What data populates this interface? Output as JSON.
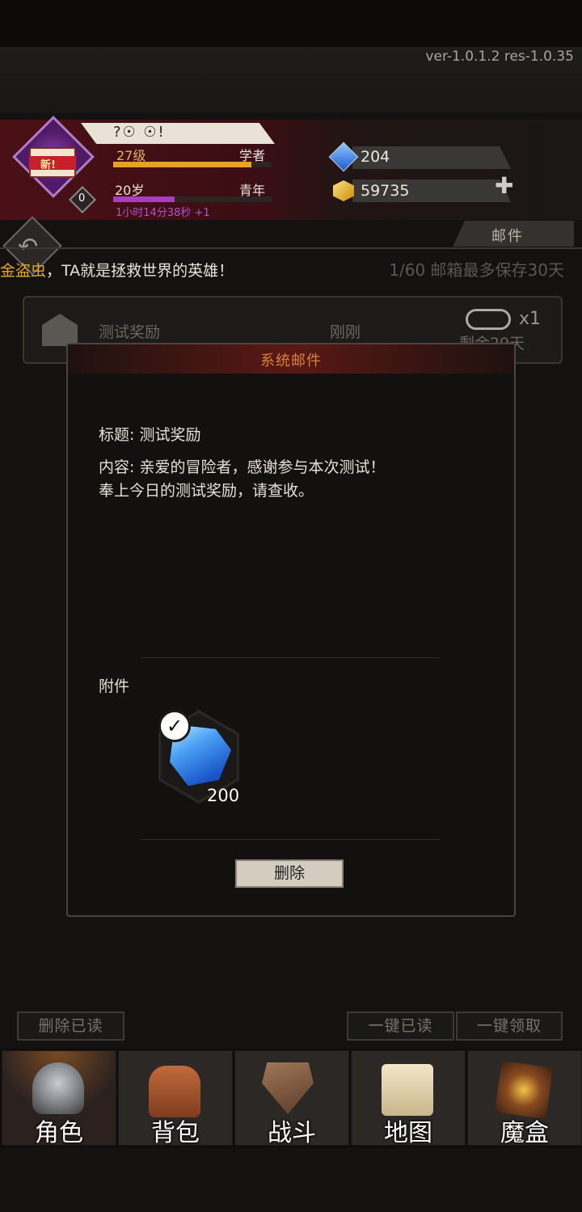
{
  "version": "ver-1.0.1.2  res-1.0.35",
  "profile": {
    "new_badge": "新!",
    "avatar_level": "0",
    "name": "?☉ ☉!",
    "level": "27级",
    "class": "学者",
    "level_progress": 0.87,
    "age": "20岁",
    "life_stage": "青年",
    "age_progress": 0.39,
    "timer": "1小时14分38秒 +1"
  },
  "resources": {
    "diamonds": "204",
    "gold": "59735",
    "add_icon": "plus-icon"
  },
  "mail_tab": "邮件",
  "ticker": {
    "highlight": "金盗虫",
    "text": "，TA就是拯救世界的英雄！"
  },
  "mailbox_status": "1/60 邮箱最多保存30天",
  "mail_list": [
    {
      "subject": "测试奖励",
      "time": "刚刚",
      "attachments": "x1",
      "remaining": "剩余29天"
    }
  ],
  "dialog": {
    "title": "系统邮件",
    "subject_line": "标题: 测试奖励",
    "content_line1": "内容: 亲爱的冒险者，感谢参与本次测试！",
    "content_line2": "奉上今日的测试奖励，请查收。",
    "attachments_label": "附件",
    "attachment_qty": "200",
    "delete_button": "删除"
  },
  "bottom_actions": {
    "delete_read": "删除已读",
    "mark_all_read": "一键已读",
    "claim_all": "一键领取"
  },
  "nav": [
    {
      "label": "角色",
      "icon": "helmet-icon"
    },
    {
      "label": "背包",
      "icon": "backpack-icon"
    },
    {
      "label": "战斗",
      "icon": "sword-shield-icon"
    },
    {
      "label": "地图",
      "icon": "scroll-map-icon"
    },
    {
      "label": "魔盒",
      "icon": "magic-box-icon"
    }
  ],
  "colors": {
    "accent_gold": "#e7a124",
    "accent_purple": "#a83dbf",
    "dialog_title": "#d8843a"
  }
}
